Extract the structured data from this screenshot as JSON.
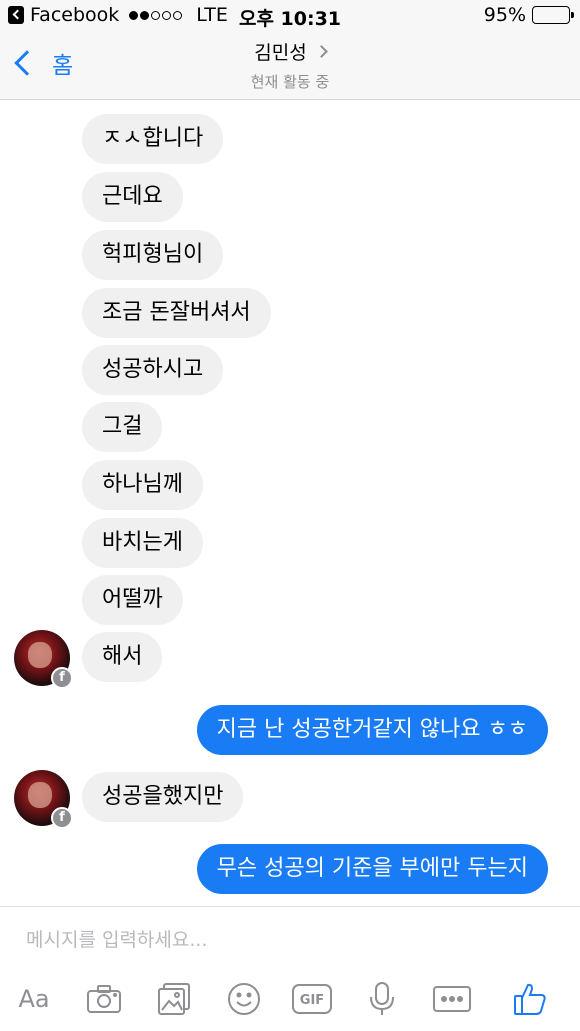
{
  "status_bar": {
    "app_back": "Facebook",
    "signal_bars": 2,
    "network": "LTE",
    "time": "오후 10:31",
    "battery_percent_text": "95%",
    "battery_level": 0.95
  },
  "header": {
    "back_label": "홈",
    "contact_name": "김민성",
    "contact_status": "현재 활동 중"
  },
  "messages": [
    {
      "side": "in",
      "text": "ㅈㅅ합니다"
    },
    {
      "side": "in",
      "text": "근데요"
    },
    {
      "side": "in",
      "text": "헉피형님이"
    },
    {
      "side": "in",
      "text": "조금 돈잘버셔서"
    },
    {
      "side": "in",
      "text": "성공하시고"
    },
    {
      "side": "in",
      "text": "그걸"
    },
    {
      "side": "in",
      "text": "하나님께"
    },
    {
      "side": "in",
      "text": "바치는게"
    },
    {
      "side": "in",
      "text": "어떨까"
    },
    {
      "side": "in",
      "text": "해서"
    },
    {
      "side": "out",
      "text": "지금 난 성공한거같지 않나요 ㅎㅎ"
    },
    {
      "side": "in",
      "text": "성공을했지만"
    },
    {
      "side": "out",
      "text": "무슨 성공의 기준을 부에만 두는지"
    }
  ],
  "composer": {
    "placeholder": "메시지를 입력하세요...",
    "aa_label": "Aa",
    "gif_label": "GIF"
  },
  "colors": {
    "accent": "#1a7cf4",
    "incoming_bubble": "#f1f0f0",
    "header_bg": "#f7f7f8"
  },
  "icons": [
    "camera-icon",
    "photo-icon",
    "emoji-icon",
    "gif-icon",
    "microphone-icon",
    "more-icon",
    "like-icon"
  ]
}
